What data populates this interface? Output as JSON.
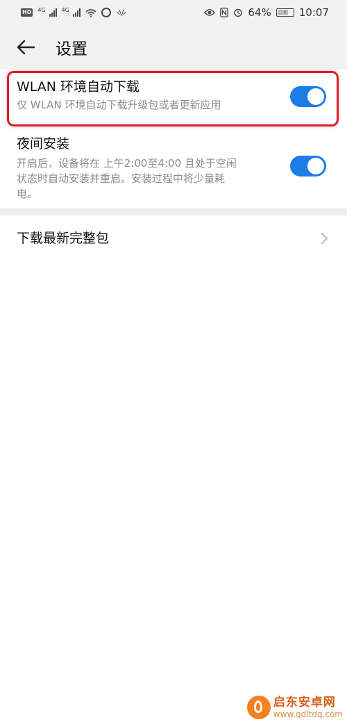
{
  "status_bar": {
    "hd_badge": "HD",
    "net1": "4G",
    "net2": "4G",
    "battery": "64%",
    "time": "10:07"
  },
  "header": {
    "title": "设置"
  },
  "settings": [
    {
      "title": "WLAN 环境自动下载",
      "subtitle": "仅 WLAN 环境自动下载升级包或者更新应用",
      "enabled": true
    },
    {
      "title": "夜间安装",
      "subtitle_lines": [
        "开启后，设备将在 上午2:00至4:00 且处于空闲",
        "状态时自动安装并重启。安装过程中将少量耗",
        "电。"
      ],
      "enabled": true
    }
  ],
  "download_full_package": {
    "label": "下载最新完整包"
  },
  "watermark": {
    "name": "启东安卓网",
    "url": "www.qdltdq.com"
  },
  "colors": {
    "toggle_on": "#1a7ee6",
    "highlight": "#d3202b",
    "header_bg": "#f2f2f2"
  }
}
